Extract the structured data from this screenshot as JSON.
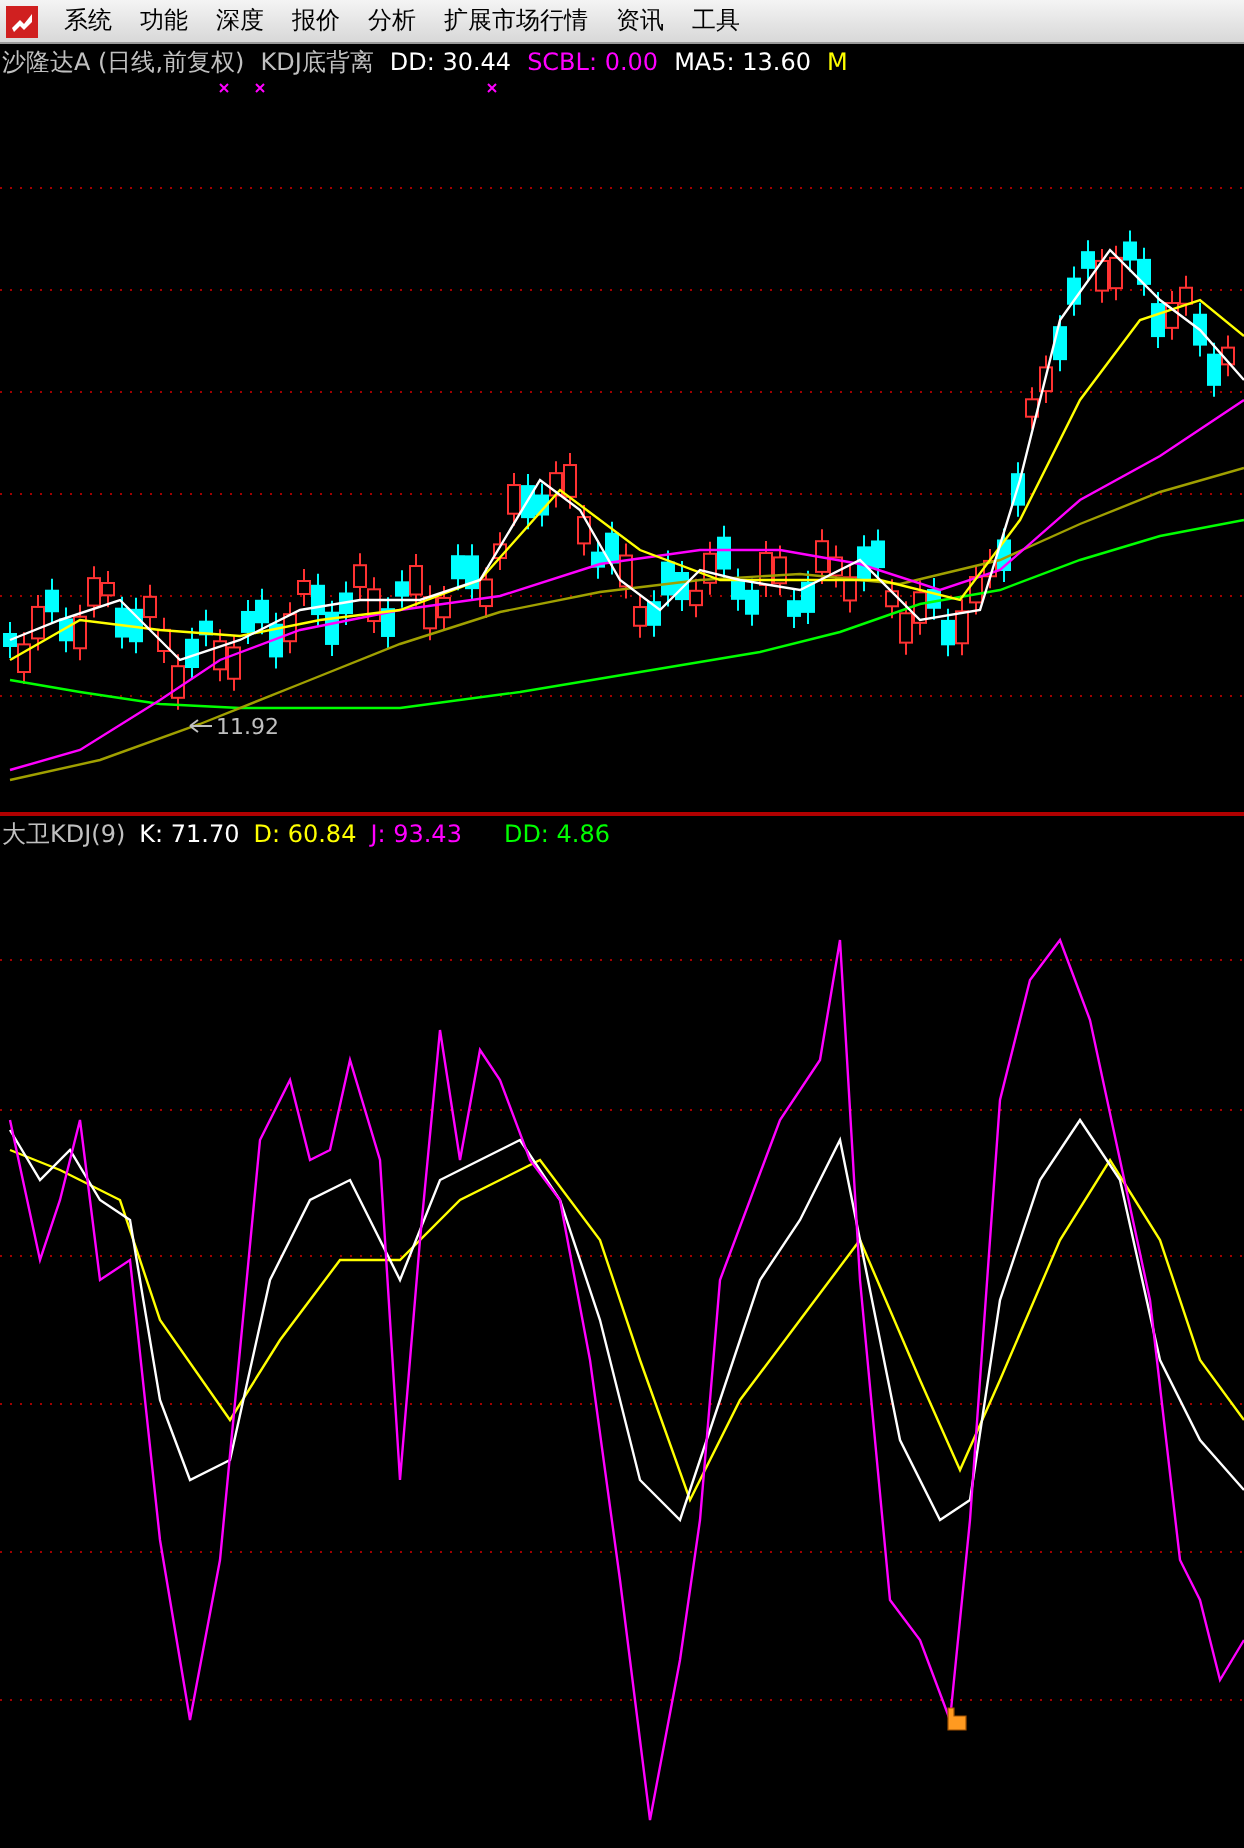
{
  "menu": {
    "items": [
      {
        "label": "系统"
      },
      {
        "label": "功能"
      },
      {
        "label": "深度"
      },
      {
        "label": "报价"
      },
      {
        "label": "分析"
      },
      {
        "label": "扩展市场行情"
      },
      {
        "label": "资讯"
      },
      {
        "label": "工具"
      }
    ]
  },
  "price_panel": {
    "legend": [
      {
        "text": "沙隆达A (日线,前复权)",
        "color": "#c0c0c0"
      },
      {
        "text": "KDJ底背离",
        "color": "#c0c0c0"
      },
      {
        "text": "DD: 30.44",
        "color": "#ffffff"
      },
      {
        "text": "SCBL: 0.00",
        "color": "#ff00ff"
      },
      {
        "text": "MA5: 13.60",
        "color": "#ffffff"
      },
      {
        "text": "M",
        "color": "#ffff00"
      }
    ],
    "low_label": "11.92"
  },
  "indicator_panel": {
    "legend": [
      {
        "text": "大卫KDJ(9)",
        "color": "#c0c0c0"
      },
      {
        "text": "K: 71.70",
        "color": "#ffffff"
      },
      {
        "text": "D: 60.84",
        "color": "#ffff00"
      },
      {
        "text": "J: 93.43",
        "color": "#ff00ff"
      },
      {
        "text": "DD: 4.86",
        "color": "#00ff00"
      }
    ]
  }
}
